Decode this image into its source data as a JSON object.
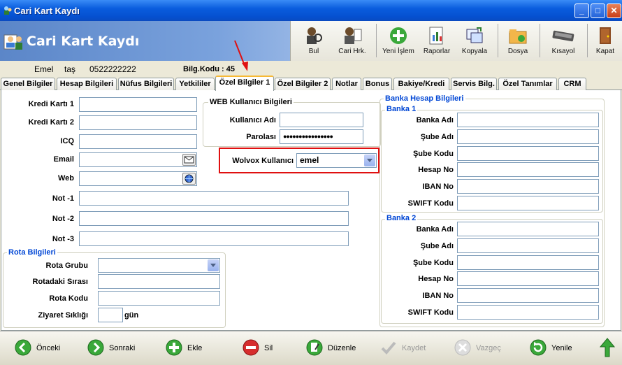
{
  "window": {
    "title": "Cari Kart Kaydı",
    "min": "_",
    "max": "□",
    "close": "✕"
  },
  "header": {
    "title": "Cari Kart Kaydı"
  },
  "toolbar": {
    "bul": "Bul",
    "cari_hrk": "Cari Hrk.",
    "yeni_islem": "Yeni İşlem",
    "raporlar": "Raporlar",
    "kopyala": "Kopyala",
    "dosya": "Dosya",
    "kisayol": "Kısayol",
    "kapat": "Kapat"
  },
  "info": {
    "name": "Emel",
    "surname": "taş",
    "phone": "0522222222",
    "bilg_kodu": "Bilg.Kodu : 45"
  },
  "tabs": {
    "genel": "Genel Bilgiler",
    "hesap": "Hesap Bilgileri",
    "nufus": "Nüfus Bilgileri",
    "yetkililer": "Yetkililer",
    "ozel1": "Özel Bilgiler 1",
    "ozel2": "Özel Bilgiler 2",
    "notlar": "Notlar",
    "bonus": "Bonus",
    "bakiye": "Bakiye/Kredi",
    "servis": "Servis Bilg.",
    "ozel_tanim": "Özel Tanımlar",
    "crm": "CRM"
  },
  "left_form": {
    "kredi1": "Kredi Kartı 1",
    "kredi2": "Kredi Kartı 2",
    "icq": "ICQ",
    "email": "Email",
    "web": "Web",
    "not1": "Not -1",
    "not2": "Not -2",
    "not3": "Not -3"
  },
  "web_user": {
    "title": "WEB Kullanıcı Bilgileri",
    "kullanici_adi": "Kullanıcı Adı",
    "parola": "Parolası",
    "parola_value": "●●●●●●●●●●●●●●●●"
  },
  "wolvox": {
    "label": "Wolvox Kullanıcı",
    "value": "emel"
  },
  "rota": {
    "title": "Rota Bilgileri",
    "grubu": "Rota Grubu",
    "sirasi": "Rotadaki Sırası",
    "kodu": "Rota Kodu",
    "siklik": "Ziyaret Sıklığı",
    "gun": "gün"
  },
  "banka": {
    "title": "Banka Hesap Bilgileri",
    "banka1": "Banka 1",
    "banka2": "Banka 2",
    "adi": "Banka Adı",
    "sube_adi": "Şube Adı",
    "sube_kodu": "Şube Kodu",
    "hesap_no": "Hesap No",
    "iban": "IBAN No",
    "swift": "SWIFT Kodu"
  },
  "bottom": {
    "onceki": "Önceki",
    "sonraki": "Sonraki",
    "ekle": "Ekle",
    "sil": "Sil",
    "duzenle": "Düzenle",
    "kaydet": "Kaydet",
    "vazgec": "Vazgeç",
    "yenile": "Yenile"
  },
  "colors": {
    "accent_red": "#e01010",
    "title_blue": "#0046d5",
    "tab_highlight": "#f7b935"
  }
}
